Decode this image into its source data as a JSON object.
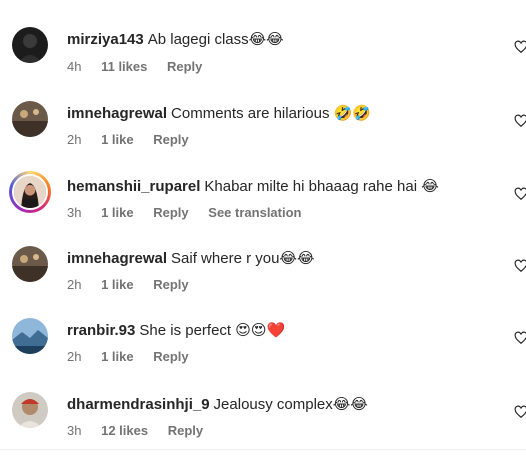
{
  "comments": [
    {
      "username": "mirziya143",
      "text": "Ab lagegi class😂😂",
      "time": "4h",
      "likes": "11 likes",
      "reply": "Reply"
    },
    {
      "username": "imnehagrewal",
      "text": "Comments are hilarious 🤣🤣",
      "time": "2h",
      "likes": "1 like",
      "reply": "Reply"
    },
    {
      "username": "hemanshii_ruparel",
      "text": "Khabar milte hi bhaaag rahe hai 😂",
      "time": "3h",
      "likes": "1 like",
      "reply": "Reply",
      "translate": "See translation"
    },
    {
      "username": "imnehagrewal",
      "text": "Saif where r you😂😂",
      "time": "2h",
      "likes": "1 like",
      "reply": "Reply"
    },
    {
      "username": "rranbir.93",
      "text": "She is perfect 😍😍❤️",
      "time": "2h",
      "likes": "1 like",
      "reply": "Reply"
    },
    {
      "username": "dharmendrasinhji_9",
      "text": "Jealousy complex😂😂",
      "time": "3h",
      "likes": "12 likes",
      "reply": "Reply"
    }
  ],
  "icons": {
    "like": "heart-outline-icon"
  },
  "colors": {
    "text": "#262626",
    "secondary": "#737373"
  }
}
